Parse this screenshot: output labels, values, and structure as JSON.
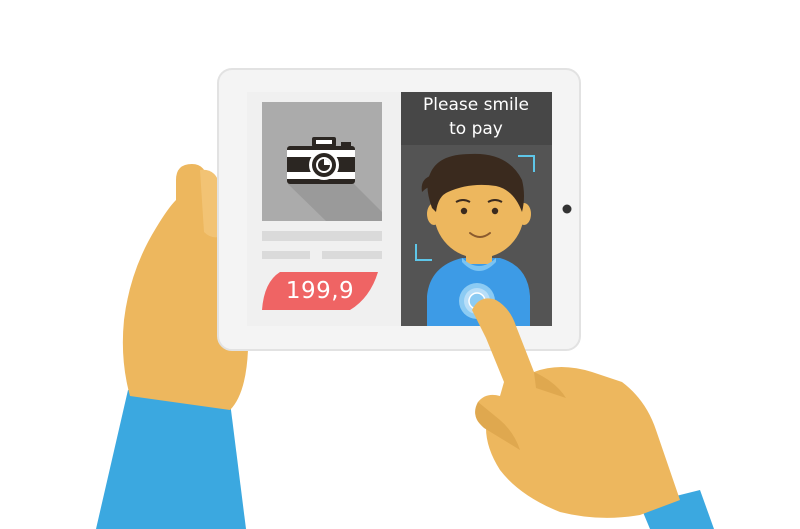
{
  "price": {
    "value": "199,9",
    "badge_color": "#EF6464"
  },
  "prompt": {
    "line1": "Please smile",
    "line2": "to pay"
  },
  "colors": {
    "tablet_frame": "#F2F2F2",
    "screen_bg": "#F0F0F0",
    "product_image_bg": "#ABABAB",
    "camera_panel_bg": "#545454",
    "prompt_bar_bg": "#474747",
    "skin": "#EDB75E",
    "sleeve": "#3BA8E0",
    "shirt": "#3D9BE6",
    "hair": "#3A2A1E",
    "face_frame": "#5EC6E8"
  },
  "icons": {
    "product": "camera-icon",
    "touch": "fingerprint-touch-icon"
  }
}
